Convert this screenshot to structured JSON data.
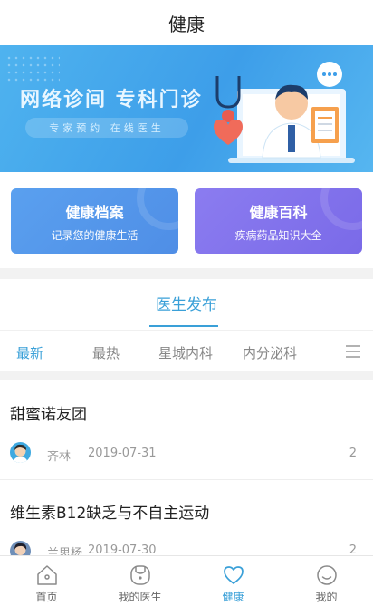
{
  "header": {
    "title": "健康"
  },
  "banner": {
    "headline": "网络诊间  专科门诊",
    "tagline": "专家预约  在线医生"
  },
  "cards": [
    {
      "title": "健康档案",
      "subtitle": "记录您的健康生活"
    },
    {
      "title": "健康百科",
      "subtitle": "疾病药品知识大全"
    }
  ],
  "section": {
    "title": "医生发布"
  },
  "tabs": [
    {
      "label": "最新",
      "active": true
    },
    {
      "label": "最热",
      "active": false
    },
    {
      "label": "星城内科",
      "active": false
    },
    {
      "label": "内分泌科",
      "active": false
    }
  ],
  "articles": [
    {
      "title": "甜蜜诺友团",
      "author": "齐林",
      "date": "2019-07-31",
      "count": "2"
    },
    {
      "title": "维生素B12缺乏与不自主运动",
      "author": "兰思杨",
      "date": "2019-07-30",
      "count": "2"
    }
  ],
  "bottom_nav": [
    {
      "label": "首页",
      "icon": "home-icon",
      "active": false
    },
    {
      "label": "我的医生",
      "icon": "doctor-icon",
      "active": false
    },
    {
      "label": "健康",
      "icon": "heart-icon",
      "active": true
    },
    {
      "label": "我的",
      "icon": "smile-icon",
      "active": false
    }
  ],
  "colors": {
    "accent": "#3aa0d8",
    "banner": "#4fb3ef",
    "card_blue": "#5aa0ef",
    "card_purple": "#8b7cf0"
  }
}
